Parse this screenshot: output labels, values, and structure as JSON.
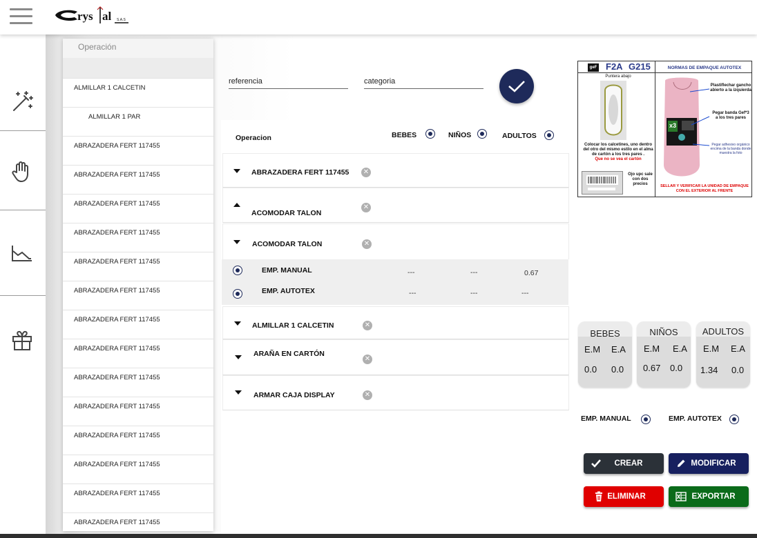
{
  "header": {
    "logo_text": "Crystal S.A.S"
  },
  "oplist": {
    "header": "Operación",
    "items": [
      {
        "label": "ALMILLAR 1 CALCETIN",
        "indent": false
      },
      {
        "label": "ALMILLAR 1 PAR",
        "indent": true
      },
      {
        "label": "ABRAZADERA FERT 117455",
        "indent": false
      },
      {
        "label": "ABRAZADERA FERT 117455",
        "indent": false
      },
      {
        "label": "ABRAZADERA FERT 117455",
        "indent": false
      },
      {
        "label": "ABRAZADERA FERT 117455",
        "indent": false
      },
      {
        "label": "ABRAZADERA FERT 117455",
        "indent": false
      },
      {
        "label": "ABRAZADERA FERT 117455",
        "indent": false
      },
      {
        "label": "ABRAZADERA FERT 117455",
        "indent": false
      },
      {
        "label": "ABRAZADERA FERT 117455",
        "indent": false
      },
      {
        "label": "ABRAZADERA FERT 117455",
        "indent": false
      },
      {
        "label": "ABRAZADERA FERT 117455",
        "indent": false
      },
      {
        "label": "ABRAZADERA FERT 117455",
        "indent": false
      },
      {
        "label": "ABRAZADERA FERT 117455",
        "indent": false
      },
      {
        "label": "ABRAZADERA FERT 117455",
        "indent": false
      },
      {
        "label": "ABRAZADERA FERT 117455",
        "indent": false
      }
    ]
  },
  "search": {
    "referencia": "referencia",
    "categoria": "categoria"
  },
  "table": {
    "col_operacion": "Operacion",
    "col_bebes": "BEBES",
    "col_ninos": "NIÑOS",
    "col_adultos": "ADULTOS",
    "groups": [
      {
        "label": "ABRAZADERA FERT 117455"
      },
      {
        "label": "ACOMODAR TALON"
      },
      {
        "label": "ACOMODAR TALON"
      },
      {
        "label": "ALMILLAR 1 CALCETIN"
      },
      {
        "label": "ARAÑA EN CARTÓN"
      },
      {
        "label": "ARMAR CAJA DISPLAY"
      }
    ],
    "subrows": [
      {
        "label": "EMP. MANUAL",
        "bebes": "---",
        "ninos": "---",
        "adultos": "0.67"
      },
      {
        "label": "EMP. AUTOTEX",
        "bebes": "---",
        "ninos": "---",
        "adultos": "---"
      }
    ]
  },
  "product": {
    "code_left": "F2A",
    "code_right": "G215",
    "brand_badge": "geF",
    "title": "NORMAS DE EMPAQUE AUTOTEX",
    "note_puntera": "Puntera abajo",
    "note_colocar": "Colocar los calcetines, uno dentro del otro del mismo estilo en el alma de cartón a los tres pares .",
    "note_carton": "Que no se vea el cartón",
    "note_upc": "Ojo upc sale con dos precios",
    "note_plastiflechar": "Plastiflechar gancho abierto a la izquierda",
    "note_banda": "Pegar banda Gef*3 a los tres pares",
    "note_adhesivo": "Pegar adhesivo orgánico encima de la banda donde muestra la foto",
    "note_sellar": "SELLAR Y VERIFICAR LA UNIDAD DE EMPAQUE CON EL EXTERIOR AL FRENTE",
    "x3_label": "x3"
  },
  "summary": [
    {
      "title": "BEBES",
      "h1": "E.M",
      "h2": "E.A",
      "v1": "0.0",
      "v2": "0.0"
    },
    {
      "title": "NIÑOS",
      "h1": "E.M",
      "h2": "E.A",
      "v1": "0.67",
      "v2": "0.0"
    },
    {
      "title": "ADULTOS",
      "h1": "E.M",
      "h2": "E.A",
      "v1": "1.34",
      "v2": "0.0"
    }
  ],
  "radios": {
    "manual": "EMP. MANUAL",
    "autotex": "EMP. AUTOTEX"
  },
  "buttons": {
    "crear": "CREAR",
    "modificar": "MODIFICAR",
    "eliminar": "ELIMINAR",
    "exportar": "EXPORTAR"
  },
  "colors": {
    "navy": "#1e2a5a",
    "crear": "#2b3138",
    "modificar": "#17205f",
    "eliminar": "#e00000",
    "exportar": "#0b6b1a"
  }
}
